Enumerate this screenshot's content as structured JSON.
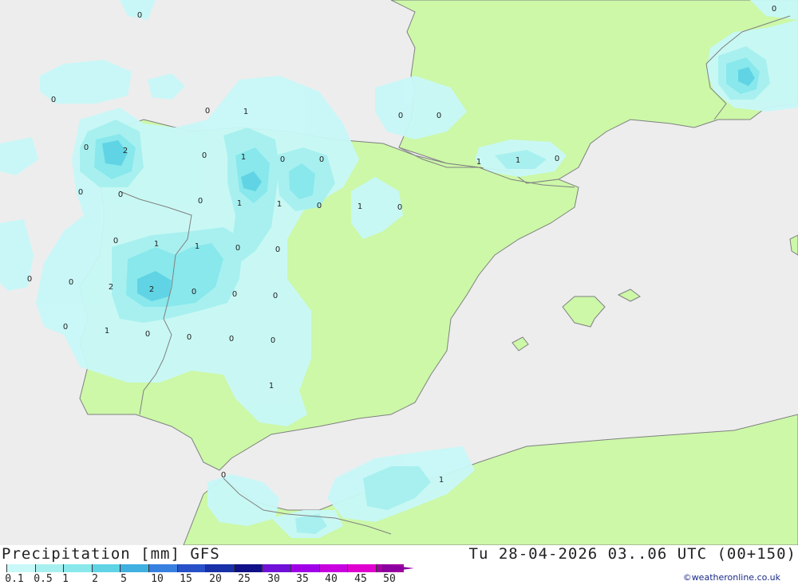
{
  "title": {
    "left": "Precipitation [mm] GFS",
    "right": "Tu 28-04-2026 03..06 UTC (00+150)"
  },
  "credit": "©weatheronline.co.uk",
  "colors": {
    "sea": "#ededed",
    "land": "#ccf8a8",
    "border": "#808080",
    "scale": [
      "#c8f8f8",
      "#a8f0f0",
      "#88e8ec",
      "#60d4e4",
      "#40b0e0",
      "#3880e0",
      "#2850c8",
      "#1830a8",
      "#101088",
      "#7010d8",
      "#a000e8",
      "#c800e0",
      "#e000d0",
      "#a000a0"
    ]
  },
  "scale": {
    "ticks": [
      "0.1",
      "0.5",
      "1",
      "2",
      "5",
      "10",
      "15",
      "20",
      "25",
      "30",
      "35",
      "40",
      "45",
      "50"
    ]
  },
  "map_labels": [
    "0",
    "0",
    "0",
    "1",
    "0",
    "0",
    "0",
    "2",
    "0",
    "0",
    "0",
    "1",
    "1",
    "0",
    "0",
    "1",
    "0",
    "0",
    "0",
    "1",
    "1",
    "1",
    "0",
    "0",
    "0",
    "1",
    "1",
    "0",
    "0",
    "0",
    "2",
    "2",
    "0",
    "0",
    "0",
    "0",
    "0",
    "1",
    "0",
    "0",
    "0",
    "0",
    "1",
    "0",
    "1"
  ]
}
